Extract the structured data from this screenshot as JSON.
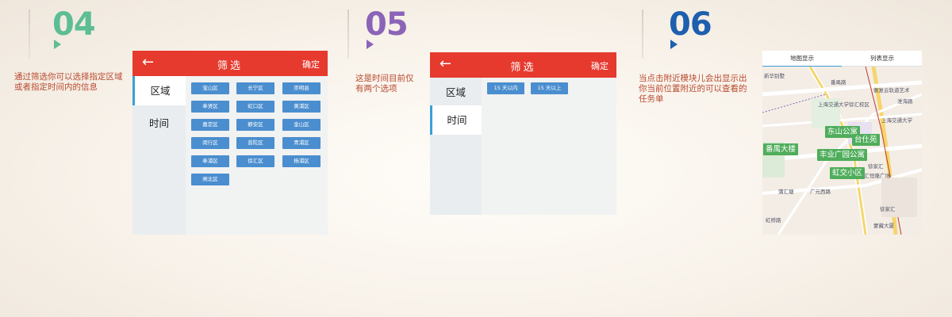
{
  "steps": [
    {
      "number": "04",
      "description": "通过筛选你可以选择指定区域或者指定时间内的信息"
    },
    {
      "number": "05",
      "description": "这是时间目前仅有两个选项"
    },
    {
      "number": "06",
      "description": "当点击附近模块儿会出显示出你当前位置附近的可以查看的任务单"
    }
  ],
  "filter_screen": {
    "back_icon": "←",
    "title": "筛选",
    "confirm": "确定",
    "tabs": [
      "区域",
      "时间"
    ]
  },
  "districts": [
    "宝山区",
    "长宁区",
    "崇明县",
    "奉贤区",
    "虹口区",
    "黄浦区",
    "嘉定区",
    "静安区",
    "金山区",
    "闵行区",
    "普陀区",
    "青浦区",
    "奉浦区",
    "徐汇区",
    "杨浦区",
    "闸北区"
  ],
  "time_options": [
    "15 天以内",
    "15 天以上"
  ],
  "map_screen": {
    "tabs": [
      "地图显示",
      "列表显示"
    ],
    "road_labels": [
      "新华别墅",
      "番禺路",
      "上海交通大学徐汇校区",
      "衡复云轨道艺术",
      "淮海路",
      "上海交通大学",
      "徐家汇",
      "广元西路",
      "港汇恒隆广场",
      "徐家汇",
      "蒲汇塘",
      "虹桥路",
      "蒙藏大厦"
    ],
    "pins": [
      "东山公寓",
      "番禺大楼",
      "台仕苑",
      "丰业广园公寓",
      "虹交小区"
    ]
  },
  "colors": {
    "header_red": "#e63a2e",
    "chip_blue": "#4a8ecf",
    "pin_green": "#4fad5b",
    "accent_blue": "#3a9fd8",
    "desc_red": "#b8492d"
  }
}
